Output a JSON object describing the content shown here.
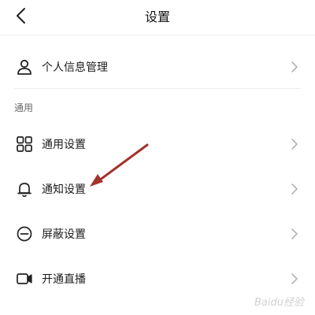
{
  "header": {
    "title": "设置",
    "back_icon": "chevron-left-icon"
  },
  "rows_top": [
    {
      "label": "个人信息管理",
      "icon": "user-icon"
    }
  ],
  "section": {
    "label": "通用"
  },
  "rows_general": [
    {
      "label": "通用设置",
      "icon": "grid-icon"
    },
    {
      "label": "通知设置",
      "icon": "bell-icon"
    },
    {
      "label": "屏蔽设置",
      "icon": "block-icon"
    },
    {
      "label": "开通直播",
      "icon": "video-camera-icon"
    }
  ],
  "watermark": "Baidu经验",
  "colors": {
    "annotation_arrow": "#a3322b",
    "separator": "#ececec",
    "chevron": "#b5b5b5"
  }
}
